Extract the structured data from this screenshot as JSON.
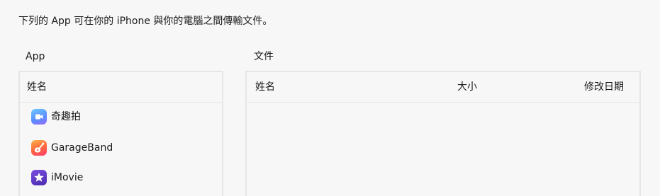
{
  "intro_text": "下列的 App 可在你的 iPhone 與你的電腦之間傳輸文件。",
  "apps_section": {
    "label": "App",
    "column_header": "姓名",
    "items": [
      {
        "label": "奇趣拍",
        "icon": "clips-icon"
      },
      {
        "label": "GarageBand",
        "icon": "garageband-icon"
      },
      {
        "label": "iMovie",
        "icon": "imovie-icon"
      }
    ]
  },
  "documents_section": {
    "label": "文件",
    "columns": [
      "姓名",
      "大小",
      "修改日期"
    ]
  }
}
